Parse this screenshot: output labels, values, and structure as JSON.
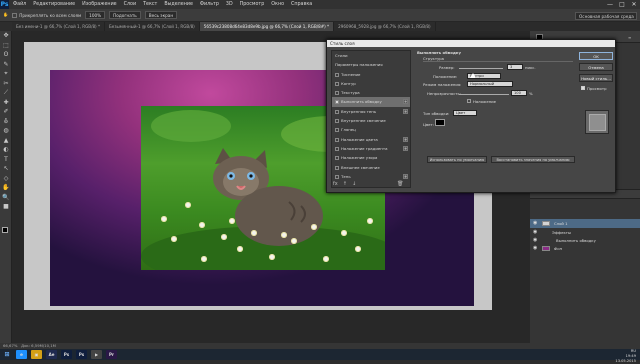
{
  "app": {
    "logo": "Ps",
    "menu": [
      "Файл",
      "Редактирование",
      "Изображение",
      "Слои",
      "Текст",
      "Выделение",
      "Фильтр",
      "3D",
      "Просмотр",
      "Окно",
      "Справка"
    ]
  },
  "window_controls": {
    "minimize": "—",
    "maximize": "□",
    "close": "✕"
  },
  "options_bar": {
    "select_label": "Прикреплять ко всем слоям",
    "zoom_label": "100%",
    "fit_label": "Подогнать",
    "fill_label": "Весь экран",
    "workspace": "Основная рабочая среда"
  },
  "tabs": [
    {
      "label": "Без имени-1 @ 66,7% (Слой 1, RGB/8) *",
      "active": false
    },
    {
      "label": "Безымянный-1 @ 66,7% (Слой 1, RGB/8)",
      "active": false
    },
    {
      "label": "56539c23808d64e83d8e9b.jpg @ 66,7% (Слой 1, RGB/8#) *",
      "active": true
    },
    {
      "label": "2960968_5928.jpg @ 66,7% (Слой 1, RGB/8)",
      "active": false
    }
  ],
  "tools": [
    "✥",
    "⬚",
    "ʘ",
    "✎",
    "⌖",
    "✂",
    "⟋",
    "✚",
    "✐",
    "⛢",
    "◍",
    "▲",
    "◐",
    "T",
    "↖",
    "◇",
    "✋",
    "🔍",
    "■"
  ],
  "status": {
    "zoom": "66,67%",
    "doc": "Док: 6,59М/10,1М"
  },
  "dialog": {
    "title": "Стиль слоя",
    "list": [
      {
        "label": "Стили",
        "checkbox": false,
        "plus": false,
        "selected": false
      },
      {
        "label": "Параметры наложения",
        "checkbox": false,
        "plus": false,
        "selected": false
      },
      {
        "label": "Тиснение",
        "checkbox": true,
        "plus": false,
        "selected": false
      },
      {
        "label": "Контур",
        "checkbox": true,
        "plus": false,
        "selected": false
      },
      {
        "label": "Текстура",
        "checkbox": true,
        "plus": false,
        "selected": false
      },
      {
        "label": "Выполнить обводку",
        "checkbox": true,
        "plus": true,
        "selected": true
      },
      {
        "label": "Внутренняя тень",
        "checkbox": true,
        "plus": true,
        "selected": false
      },
      {
        "label": "Внутреннее свечение",
        "checkbox": true,
        "plus": false,
        "selected": false
      },
      {
        "label": "Глянец",
        "checkbox": true,
        "plus": false,
        "selected": false
      },
      {
        "label": "Наложение цвета",
        "checkbox": true,
        "plus": true,
        "selected": false
      },
      {
        "label": "Наложение градиента",
        "checkbox": true,
        "plus": true,
        "selected": false
      },
      {
        "label": "Наложение узора",
        "checkbox": true,
        "plus": false,
        "selected": false
      },
      {
        "label": "Внешнее свечение",
        "checkbox": true,
        "plus": false,
        "selected": false
      },
      {
        "label": "Тень",
        "checkbox": true,
        "plus": true,
        "selected": false
      }
    ],
    "list_tools": [
      "fx",
      "↑",
      "↓",
      "🗑"
    ],
    "settings": {
      "section": "Выполнить обводку",
      "subsection": "Структура",
      "size_label": "Размер:",
      "size_value": "3",
      "size_unit": "пикс.",
      "position_label": "Положение:",
      "position_value": "Внутри",
      "blend_label": "Режим наложения:",
      "blend_value": "Нормальный",
      "opacity_label": "Непрозрачность:",
      "opacity_value": "100",
      "opacity_unit": "%",
      "overprint_label": "Наложение",
      "filltype_label": "Тип обводки:",
      "filltype_value": "Цвет",
      "color_label": "Цвет:",
      "color_value": "#000000",
      "btn_default": "Использовать по умолчанию",
      "btn_reset": "Восстановить значения по умолчанию"
    },
    "buttons": {
      "ok": "OK",
      "cancel": "Отмена",
      "new_style": "Новый стиль...",
      "preview_label": "Просмотр"
    }
  },
  "layers": [
    {
      "name": "Слой 1",
      "kind": "layer"
    },
    {
      "name": "Эффекты",
      "kind": "effects"
    },
    {
      "name": "Выполнить обводку",
      "kind": "effect"
    },
    {
      "name": "Фон",
      "kind": "background"
    }
  ],
  "taskbar": {
    "apps": [
      "e",
      "▣",
      "Ae",
      "Ps",
      "Ps",
      "▶",
      "Pr"
    ],
    "app_colors": [
      "#1e90ff",
      "#d4a017",
      "#1f2a50",
      "#0f1e3d",
      "#0f1e3d",
      "#444444",
      "#2a1846"
    ],
    "language": "RU",
    "time": "19:49",
    "date": "13.05.2015"
  },
  "colors": {
    "accent": "#31a8ff",
    "workspace": "#282828"
  }
}
